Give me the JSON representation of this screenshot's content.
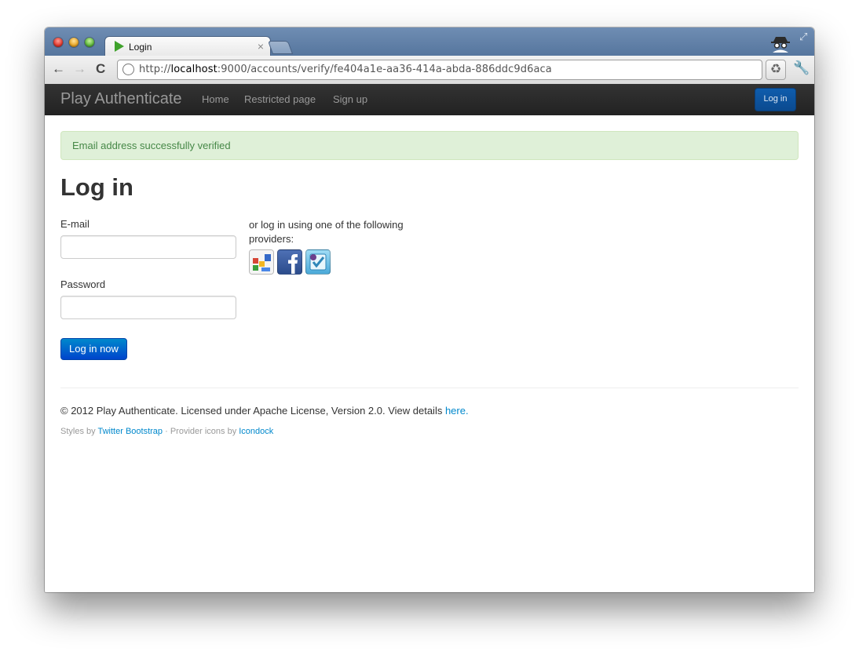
{
  "browser": {
    "tab_title": "Login",
    "tab_close": "×",
    "url_prefix": "http://",
    "url_host": "localhost",
    "url_rest": ":9000/accounts/verify/fe404a1e-aa36-414a-abda-886ddc9d6aca",
    "back_glyph": "←",
    "forward_glyph": "→",
    "reload_glyph": "C",
    "recycle_glyph": "♻",
    "wrench_glyph": "🔧",
    "fullscreen_glyph": "⤢"
  },
  "navbar": {
    "brand": "Play Authenticate",
    "links": [
      "Home",
      "Restricted page",
      "Sign up"
    ],
    "login_button": "Log in",
    "background": "#222222"
  },
  "alert": {
    "text": "Email address successfully verified",
    "color": "#468847",
    "background": "#dff0d8"
  },
  "form": {
    "heading": "Log in",
    "email_label": "E-mail",
    "email_value": "",
    "password_label": "Password",
    "password_value": "",
    "submit_label": "Log in now",
    "providers_text": "or log in using one of the following providers:",
    "providers": [
      "google",
      "facebook",
      "foursquare"
    ]
  },
  "footer": {
    "line1_text": "© 2012 Play Authenticate. Licensed under Apache License, Version 2.0. View details ",
    "line1_link": "here",
    "line1_end": ".",
    "styles_by": "Styles by ",
    "bootstrap_link": "Twitter Bootstrap",
    "icons_by": " · Provider icons by ",
    "icondock_link": "Icondock"
  },
  "colors": {
    "link": "#0088cc",
    "primary_button": "#0074cc"
  }
}
